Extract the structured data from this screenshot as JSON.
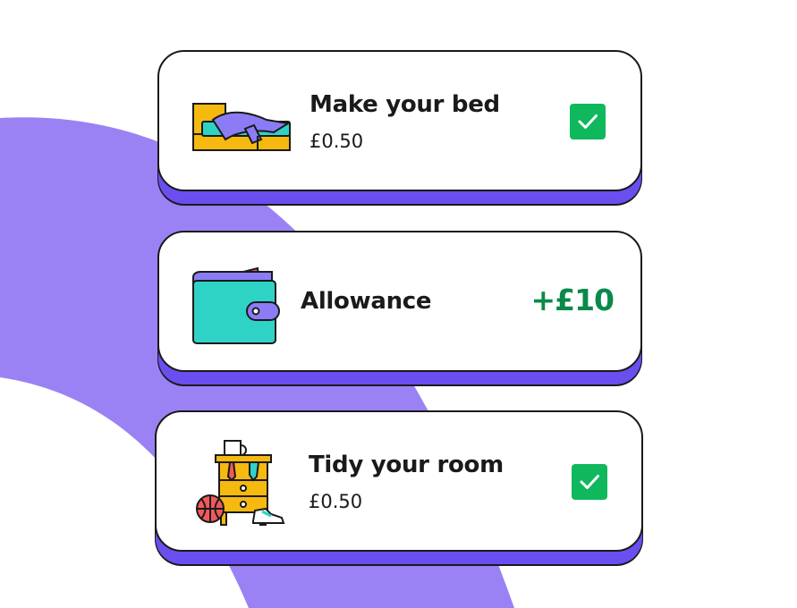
{
  "tasks": [
    {
      "illustration": "bed-icon",
      "title": "Make your bed",
      "amount": "£0.50",
      "completed": true
    },
    {
      "illustration": "wallet-icon",
      "title": "Allowance",
      "credit": "+£10"
    },
    {
      "illustration": "tidy-room-icon",
      "title": "Tidy your room",
      "amount": "£0.50",
      "completed": true
    }
  ],
  "colors": {
    "accent_purple": "#6b4ef0",
    "background_arc": "#9a82f5",
    "check_green": "#0fb85c",
    "credit_green": "#0a8a4a"
  }
}
